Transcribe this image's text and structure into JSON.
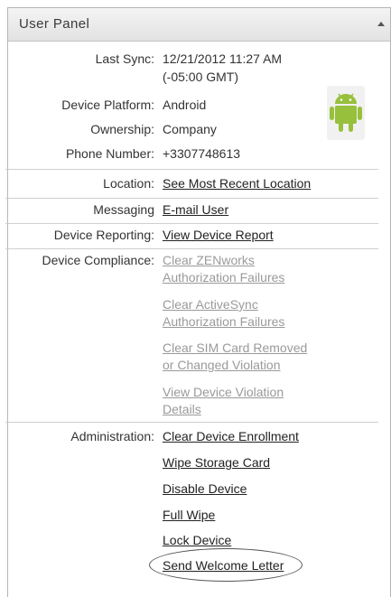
{
  "panel": {
    "title": "User Panel"
  },
  "icons": {
    "collapse": "collapse-arrow-icon",
    "device": "android-robot-icon"
  },
  "colors": {
    "android_green": "#97c03c",
    "disabled_link": "#9a9a9a"
  },
  "info": {
    "last_sync_label": "Last Sync:",
    "last_sync_value": "12/21/2012 11:27 AM",
    "last_sync_tz": "(-05:00 GMT)",
    "platform_label": "Device Platform:",
    "platform_value": "Android",
    "ownership_label": "Ownership:",
    "ownership_value": "Company",
    "phone_label": "Phone Number:",
    "phone_value": "+3307748613"
  },
  "location": {
    "label": "Location:",
    "link": "See Most Recent Location"
  },
  "messaging": {
    "label": "Messaging",
    "link": "E-mail User"
  },
  "reporting": {
    "label": "Device Reporting:",
    "link": "View Device Report"
  },
  "compliance": {
    "label": "Device Compliance:",
    "links": [
      {
        "line1": "Clear ZENworks",
        "line2": "Authorization Failures"
      },
      {
        "line1": "Clear ActiveSync",
        "line2": "Authorization Failures"
      },
      {
        "line1": "Clear SIM Card Removed",
        "line2": "or Changed Violation"
      },
      {
        "line1": "View Device Violation",
        "line2": "Details"
      }
    ]
  },
  "administration": {
    "label": "Administration:",
    "links": [
      "Clear Device Enrollment",
      "Wipe Storage Card",
      "Disable Device",
      "Full Wipe",
      "Lock Device",
      "Send Welcome Letter"
    ]
  }
}
